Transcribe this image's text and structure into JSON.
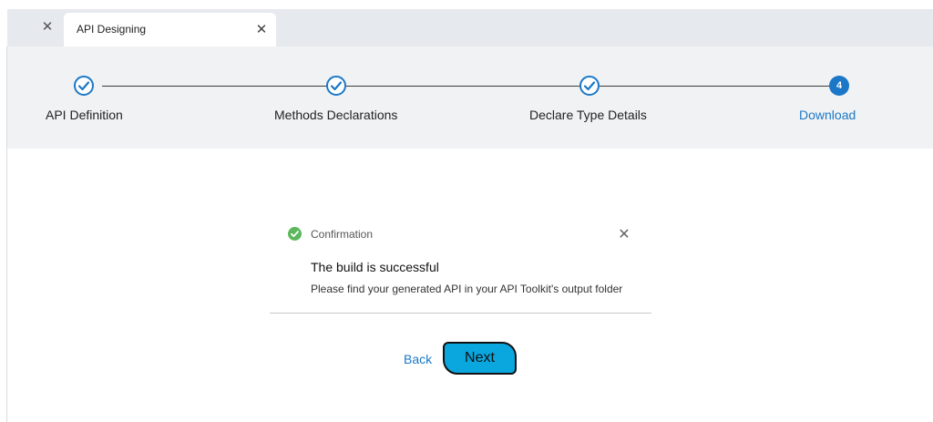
{
  "tabs": [
    {
      "title": "API Designing"
    }
  ],
  "stepper": {
    "steps": [
      {
        "label": "API Definition",
        "status": "done"
      },
      {
        "label": "Methods Declarations",
        "status": "done"
      },
      {
        "label": "Declare Type Details",
        "status": "done"
      },
      {
        "label": "Download",
        "status": "active",
        "number": "4"
      }
    ]
  },
  "confirmation": {
    "title": "Confirmation",
    "heading": "The build is successful",
    "message": "Please find your generated API in your API Toolkit's output folder"
  },
  "actions": {
    "back_label": "Back",
    "next_label": "Next"
  },
  "colors": {
    "accent": "#1b78c8",
    "next_button": "#0aa6de",
    "success": "#5cb85c"
  },
  "icons": {
    "tab_extra_close": "close-icon",
    "tab_close": "close-icon",
    "step_done": "checkmark-icon",
    "confirmation": "check-circle-icon",
    "dismiss": "close-icon"
  }
}
